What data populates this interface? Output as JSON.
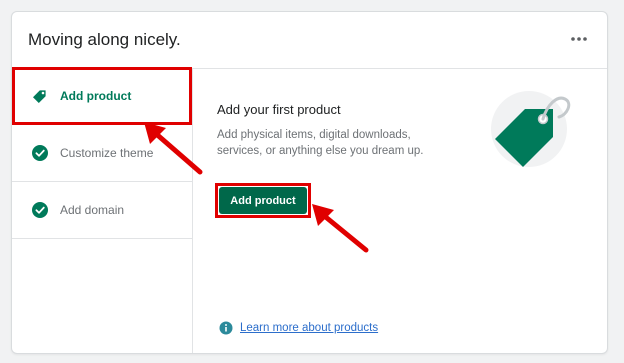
{
  "card": {
    "title": "Moving along nicely.",
    "more_label": "More actions"
  },
  "sidebar": {
    "steps": [
      {
        "label": "Add product",
        "state": "active",
        "icon": "tag-icon"
      },
      {
        "label": "Customize theme",
        "state": "completed",
        "icon": "checkmark-circle-icon"
      },
      {
        "label": "Add domain",
        "state": "completed",
        "icon": "checkmark-circle-icon"
      }
    ]
  },
  "main": {
    "heading": "Add your first product",
    "description": "Add physical items, digital downloads, services, or anything else you dream up.",
    "primary_button": "Add product",
    "learn_more": "Learn more about products",
    "illustration": "price-tag-illustration"
  },
  "annotations": {
    "highlight_color": "#e00000",
    "arrow_color": "#e00000"
  },
  "colors": {
    "brand_green": "#00684a",
    "link_blue": "#2c6ecb"
  }
}
